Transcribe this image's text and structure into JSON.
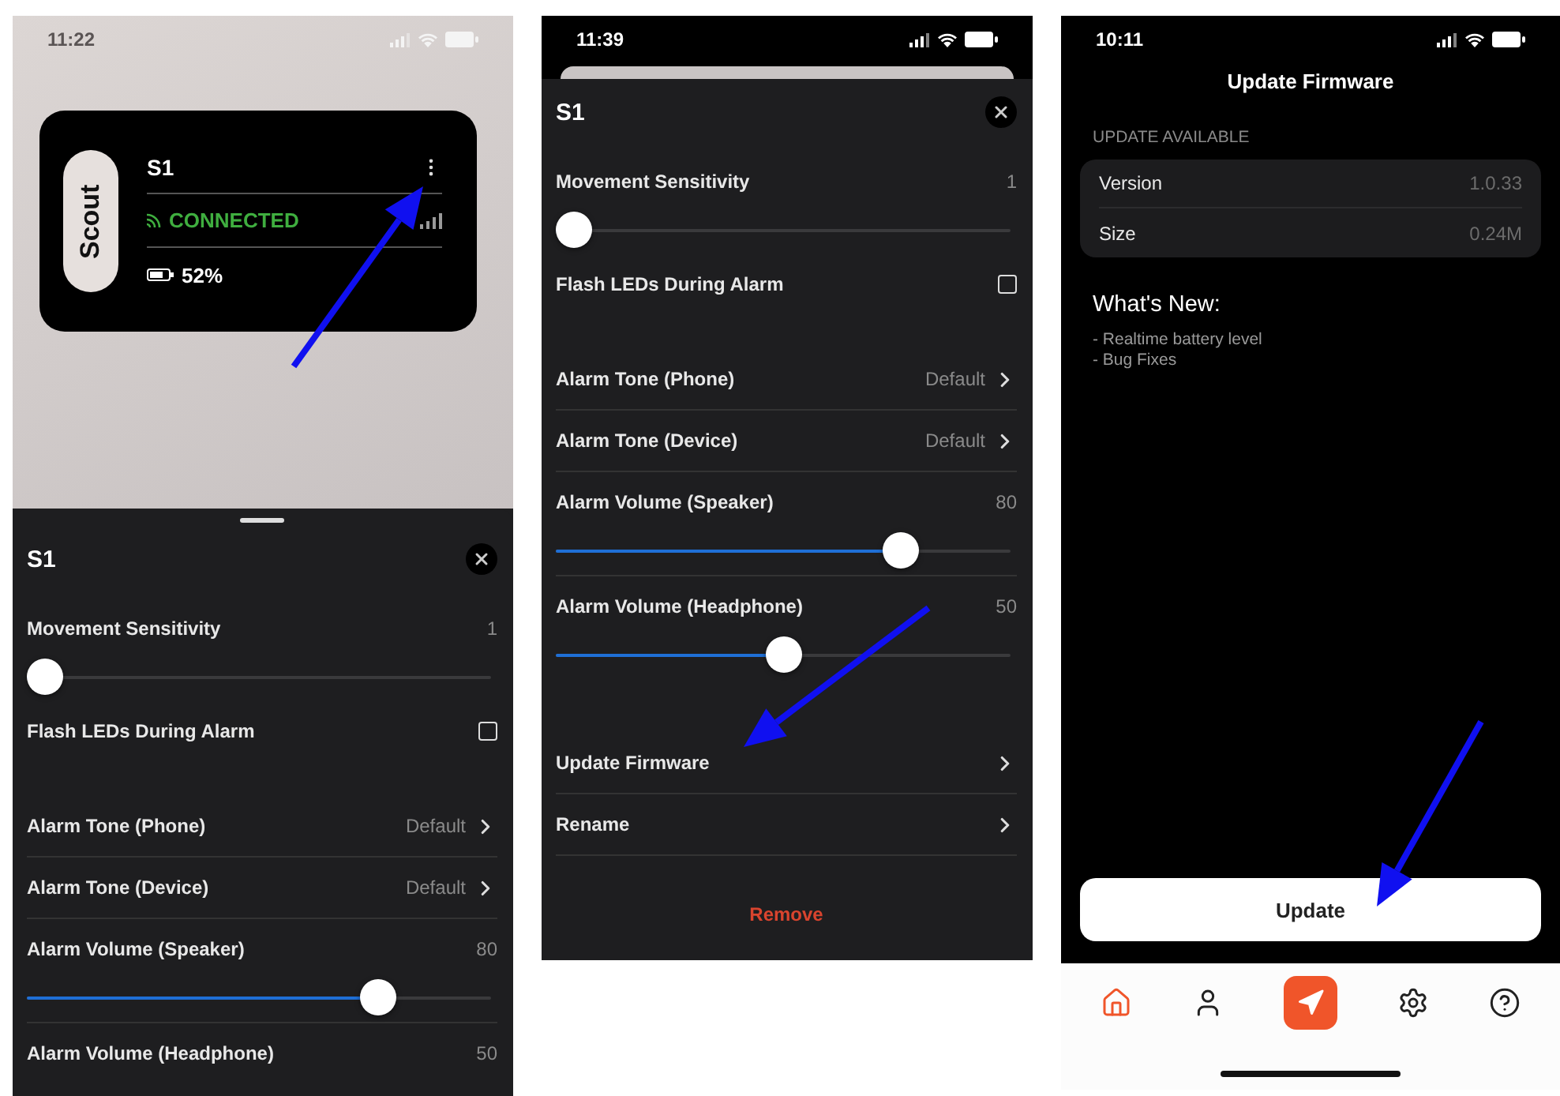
{
  "phones": [
    {
      "kind": "device_sheet",
      "status_time": "11:22",
      "device_card": {
        "badge": "Scout",
        "name": "S1",
        "status": "CONNECTED",
        "battery": "52%"
      },
      "sheet": {
        "handle": true,
        "title": "S1",
        "rows": [
          {
            "kind": "slider",
            "label": "Movement Sensitivity",
            "value": "1",
            "level": 0
          },
          {
            "kind": "checkbox",
            "label": "Flash LEDs During Alarm",
            "checked": false
          },
          {
            "kind": "link",
            "label": "Alarm Tone (Phone)",
            "value": "Default"
          },
          {
            "kind": "link",
            "label": "Alarm Tone (Device)",
            "value": "Default"
          },
          {
            "kind": "slider",
            "label": "Alarm Volume (Speaker)",
            "value": "80",
            "level": 0.78
          },
          {
            "kind": "slider",
            "label": "Alarm Volume (Headphone)",
            "value": "50"
          }
        ]
      }
    },
    {
      "kind": "settings_sheet",
      "status_time": "11:39",
      "sheet": {
        "handle": false,
        "title": "S1",
        "rows": [
          {
            "kind": "slider",
            "label": "Movement Sensitivity",
            "value": "1",
            "level": 0
          },
          {
            "kind": "checkbox",
            "label": "Flash LEDs During Alarm",
            "checked": false
          },
          {
            "kind": "link",
            "label": "Alarm Tone (Phone)",
            "value": "Default"
          },
          {
            "kind": "link",
            "label": "Alarm Tone (Device)",
            "value": "Default"
          },
          {
            "kind": "slider",
            "label": "Alarm Volume (Speaker)",
            "value": "80",
            "level": 0.78
          },
          {
            "kind": "slider",
            "label": "Alarm Volume (Headphone)",
            "value": "50",
            "level": 0.5
          },
          {
            "kind": "link",
            "label": "Update Firmware"
          },
          {
            "kind": "link",
            "label": "Rename"
          },
          {
            "kind": "danger",
            "label": "Remove"
          }
        ]
      }
    },
    {
      "kind": "firmware",
      "status_time": "10:11",
      "title": "Update Firmware",
      "section": "UPDATE AVAILABLE",
      "details": [
        {
          "label": "Version",
          "value": "1.0.33"
        },
        {
          "label": "Size",
          "value": "0.24M"
        }
      ],
      "whats_new": {
        "heading": "What's New:",
        "lines": [
          "- Realtime battery level",
          "- Bug Fixes"
        ]
      },
      "button": "Update",
      "tab_bar": [
        {
          "kind": "tab",
          "selected": true
        },
        {
          "kind": "tab",
          "selected": false
        },
        {
          "kind": "action"
        },
        {
          "kind": "tab",
          "selected": false
        },
        {
          "kind": "tab",
          "selected": false
        }
      ]
    }
  ]
}
